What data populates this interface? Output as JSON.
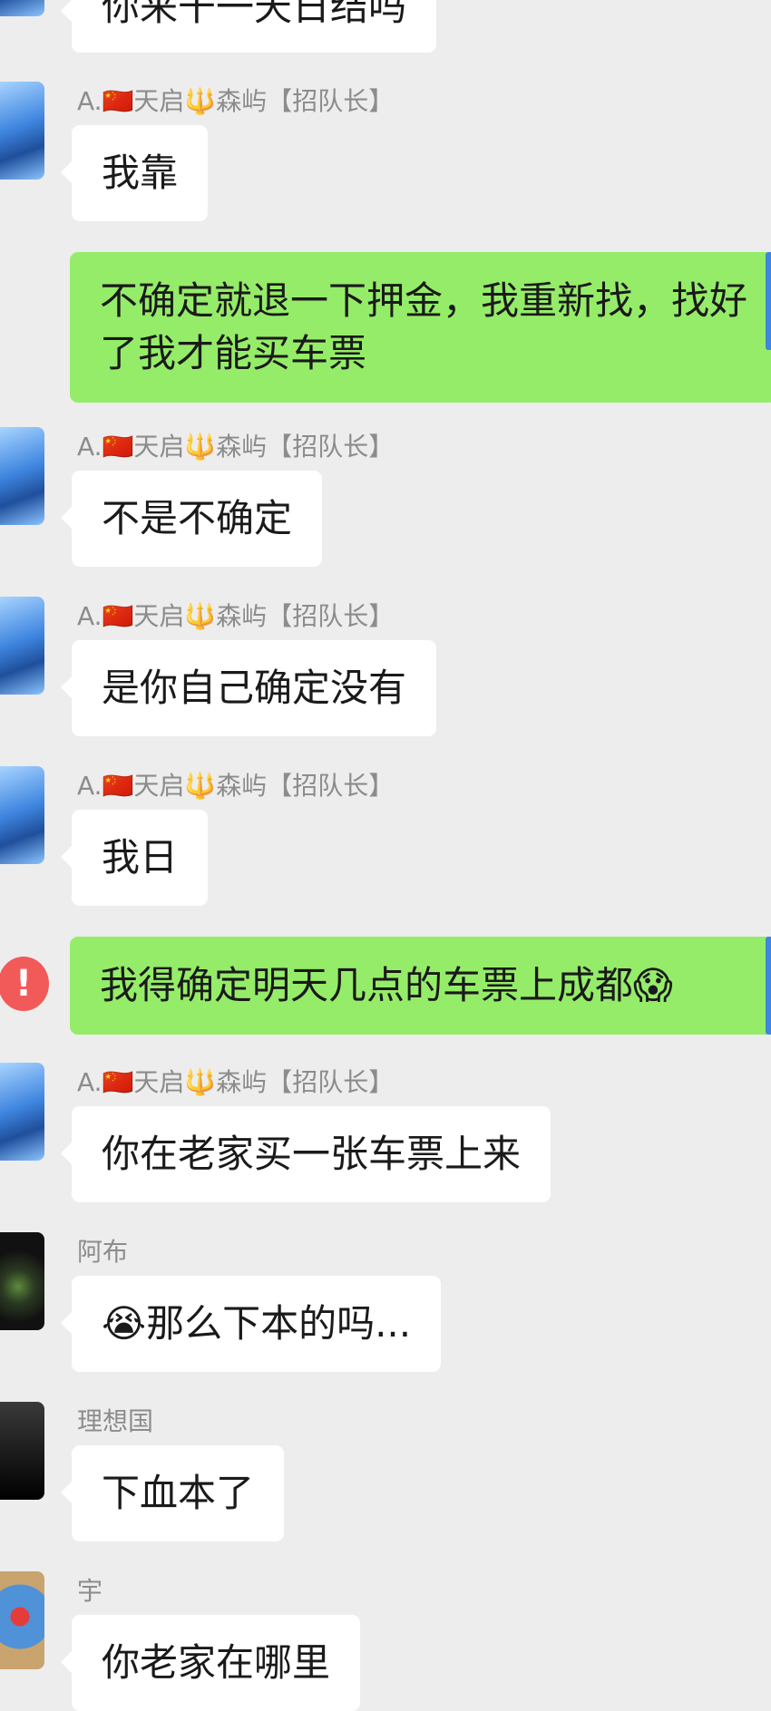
{
  "messages": [
    {
      "sender": "",
      "text": "你来干一天日结吗",
      "side": "left"
    },
    {
      "sender": "A.🇨🇳天启🔱森屿【招队长】",
      "text": "我靠",
      "side": "left"
    },
    {
      "sender": "",
      "text": "不确定就退一下押金，我重新找，找好了我才能买车票",
      "side": "right"
    },
    {
      "sender": "A.🇨🇳天启🔱森屿【招队长】",
      "text": "不是不确定",
      "side": "left"
    },
    {
      "sender": "A.🇨🇳天启🔱森屿【招队长】",
      "text": "是你自己确定没有",
      "side": "left"
    },
    {
      "sender": "A.🇨🇳天启🔱森屿【招队长】",
      "text": "我日",
      "side": "left"
    },
    {
      "sender": "",
      "text": "我得确定明天几点的车票上成都😱",
      "side": "right",
      "error": "!"
    },
    {
      "sender": "A.🇨🇳天启🔱森屿【招队长】",
      "text": "你在老家买一张车票上来",
      "side": "left"
    },
    {
      "sender": "阿布",
      "text": "😭那么下本的吗...",
      "side": "left"
    },
    {
      "sender": "理想国",
      "text": "下血本了",
      "side": "left"
    },
    {
      "sender": "宇",
      "text": "你老家在哪里",
      "side": "left"
    }
  ],
  "colors": {
    "background": "#ededed",
    "incoming_bubble": "#ffffff",
    "outgoing_bubble": "#95ec69",
    "sender_name": "#8c8c8c",
    "error_badge": "#f25a5a"
  }
}
